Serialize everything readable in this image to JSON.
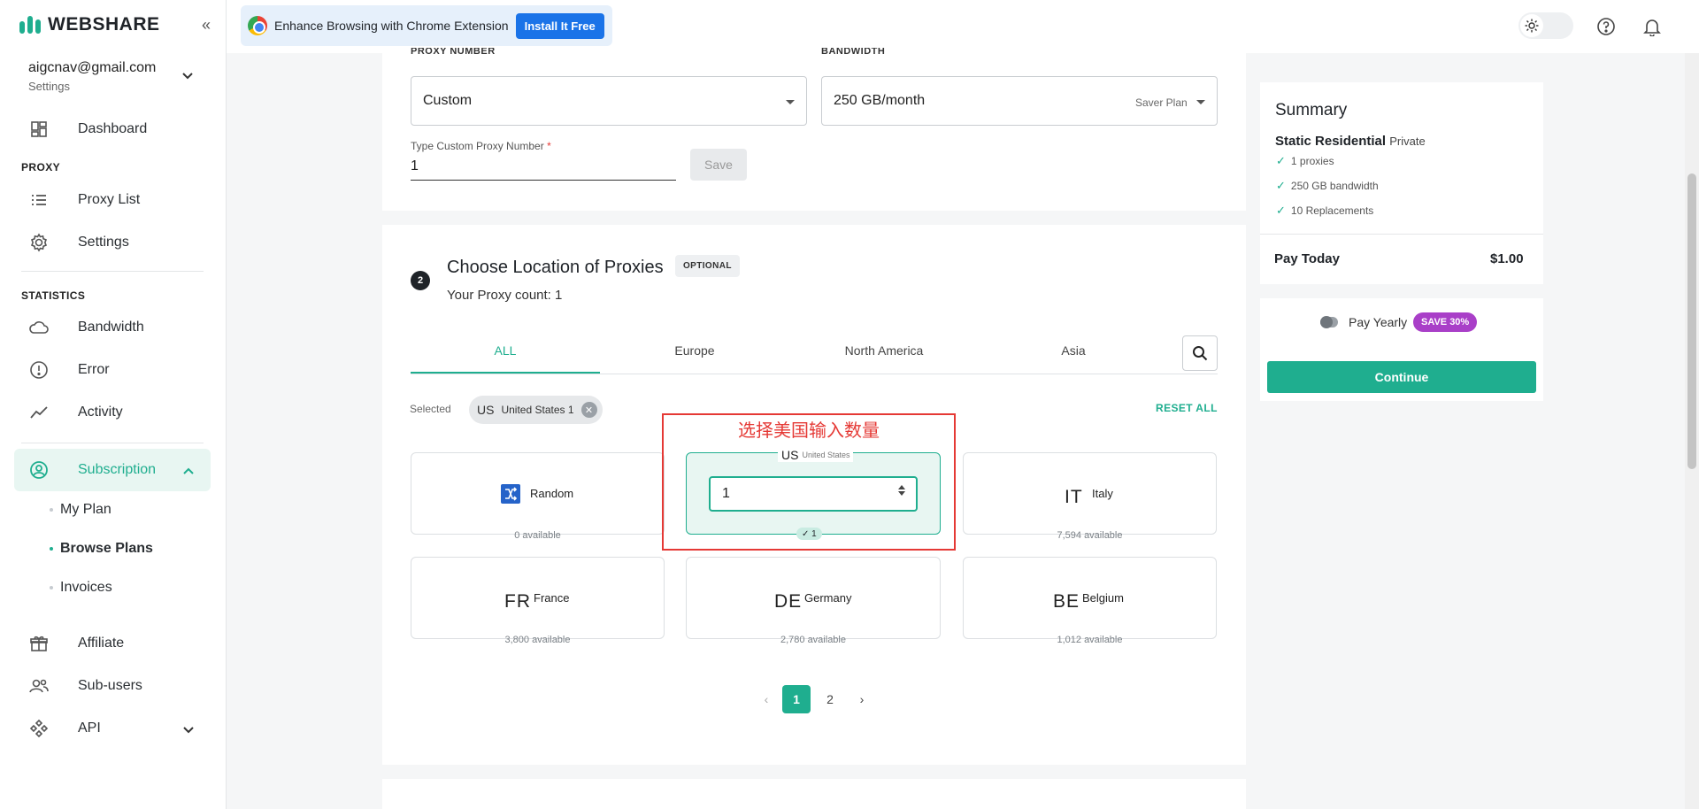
{
  "brand": {
    "name": "WEBSHARE",
    "accent": "#1fae8f"
  },
  "account": {
    "email": "aigcnav@gmail.com",
    "subtitle": "Settings"
  },
  "sidebar": {
    "dashboard": "Dashboard",
    "section_proxy": "PROXY",
    "proxy_list": "Proxy List",
    "settings": "Settings",
    "section_statistics": "STATISTICS",
    "bandwidth": "Bandwidth",
    "error": "Error",
    "activity": "Activity",
    "subscription": "Subscription",
    "sub_items": [
      "My Plan",
      "Browse Plans",
      "Invoices"
    ],
    "affiliate": "Affiliate",
    "subusers": "Sub-users",
    "api": "API"
  },
  "topbar": {
    "ext_text": "Enhance Browsing with Chrome Extension",
    "install_label": "Install It Free"
  },
  "plan": {
    "proxy_number_label": "PROXY NUMBER",
    "proxy_number_value": "Custom",
    "bandwidth_label": "BANDWIDTH",
    "bandwidth_value": "250 GB/month",
    "bandwidth_plan": "Saver Plan",
    "custom_label": "Type Custom Proxy Number",
    "custom_required": "*",
    "custom_value": "1",
    "save_label": "Save"
  },
  "location": {
    "step": "2",
    "title": "Choose Location of Proxies",
    "optional_badge": "OPTIONAL",
    "proxy_count": "Your Proxy count: 1",
    "tabs": [
      "ALL",
      "Europe",
      "North America",
      "Asia"
    ],
    "selected_label": "Selected",
    "chip_code": "US",
    "chip_text": "United States 1",
    "reset_label": "RESET ALL",
    "annotation": "选择美国输入数量",
    "cards": [
      {
        "code": "",
        "name": "Random",
        "available": "0 available"
      },
      {
        "code": "US",
        "name": "United States",
        "qty": "1",
        "badge": "✓ 1"
      },
      {
        "code": "IT",
        "name": "Italy",
        "available": "7,594 available"
      },
      {
        "code": "FR",
        "name": "France",
        "available": "3,800 available"
      },
      {
        "code": "DE",
        "name": "Germany",
        "available": "2,780 available"
      },
      {
        "code": "BE",
        "name": "Belgium",
        "available": "1,012 available"
      }
    ],
    "pagination": {
      "prev": "‹",
      "pages": [
        "1",
        "2"
      ],
      "next": "›"
    }
  },
  "summary": {
    "title": "Summary",
    "plan_name": "Static Residential",
    "plan_type": "Private",
    "features": [
      "1 proxies",
      "250 GB bandwidth",
      "10 Replacements"
    ],
    "pay_today_label": "Pay Today",
    "pay_today_value": "$1.00",
    "pay_yearly_label": "Pay Yearly",
    "save_badge": "SAVE 30%",
    "continue_label": "Continue"
  }
}
